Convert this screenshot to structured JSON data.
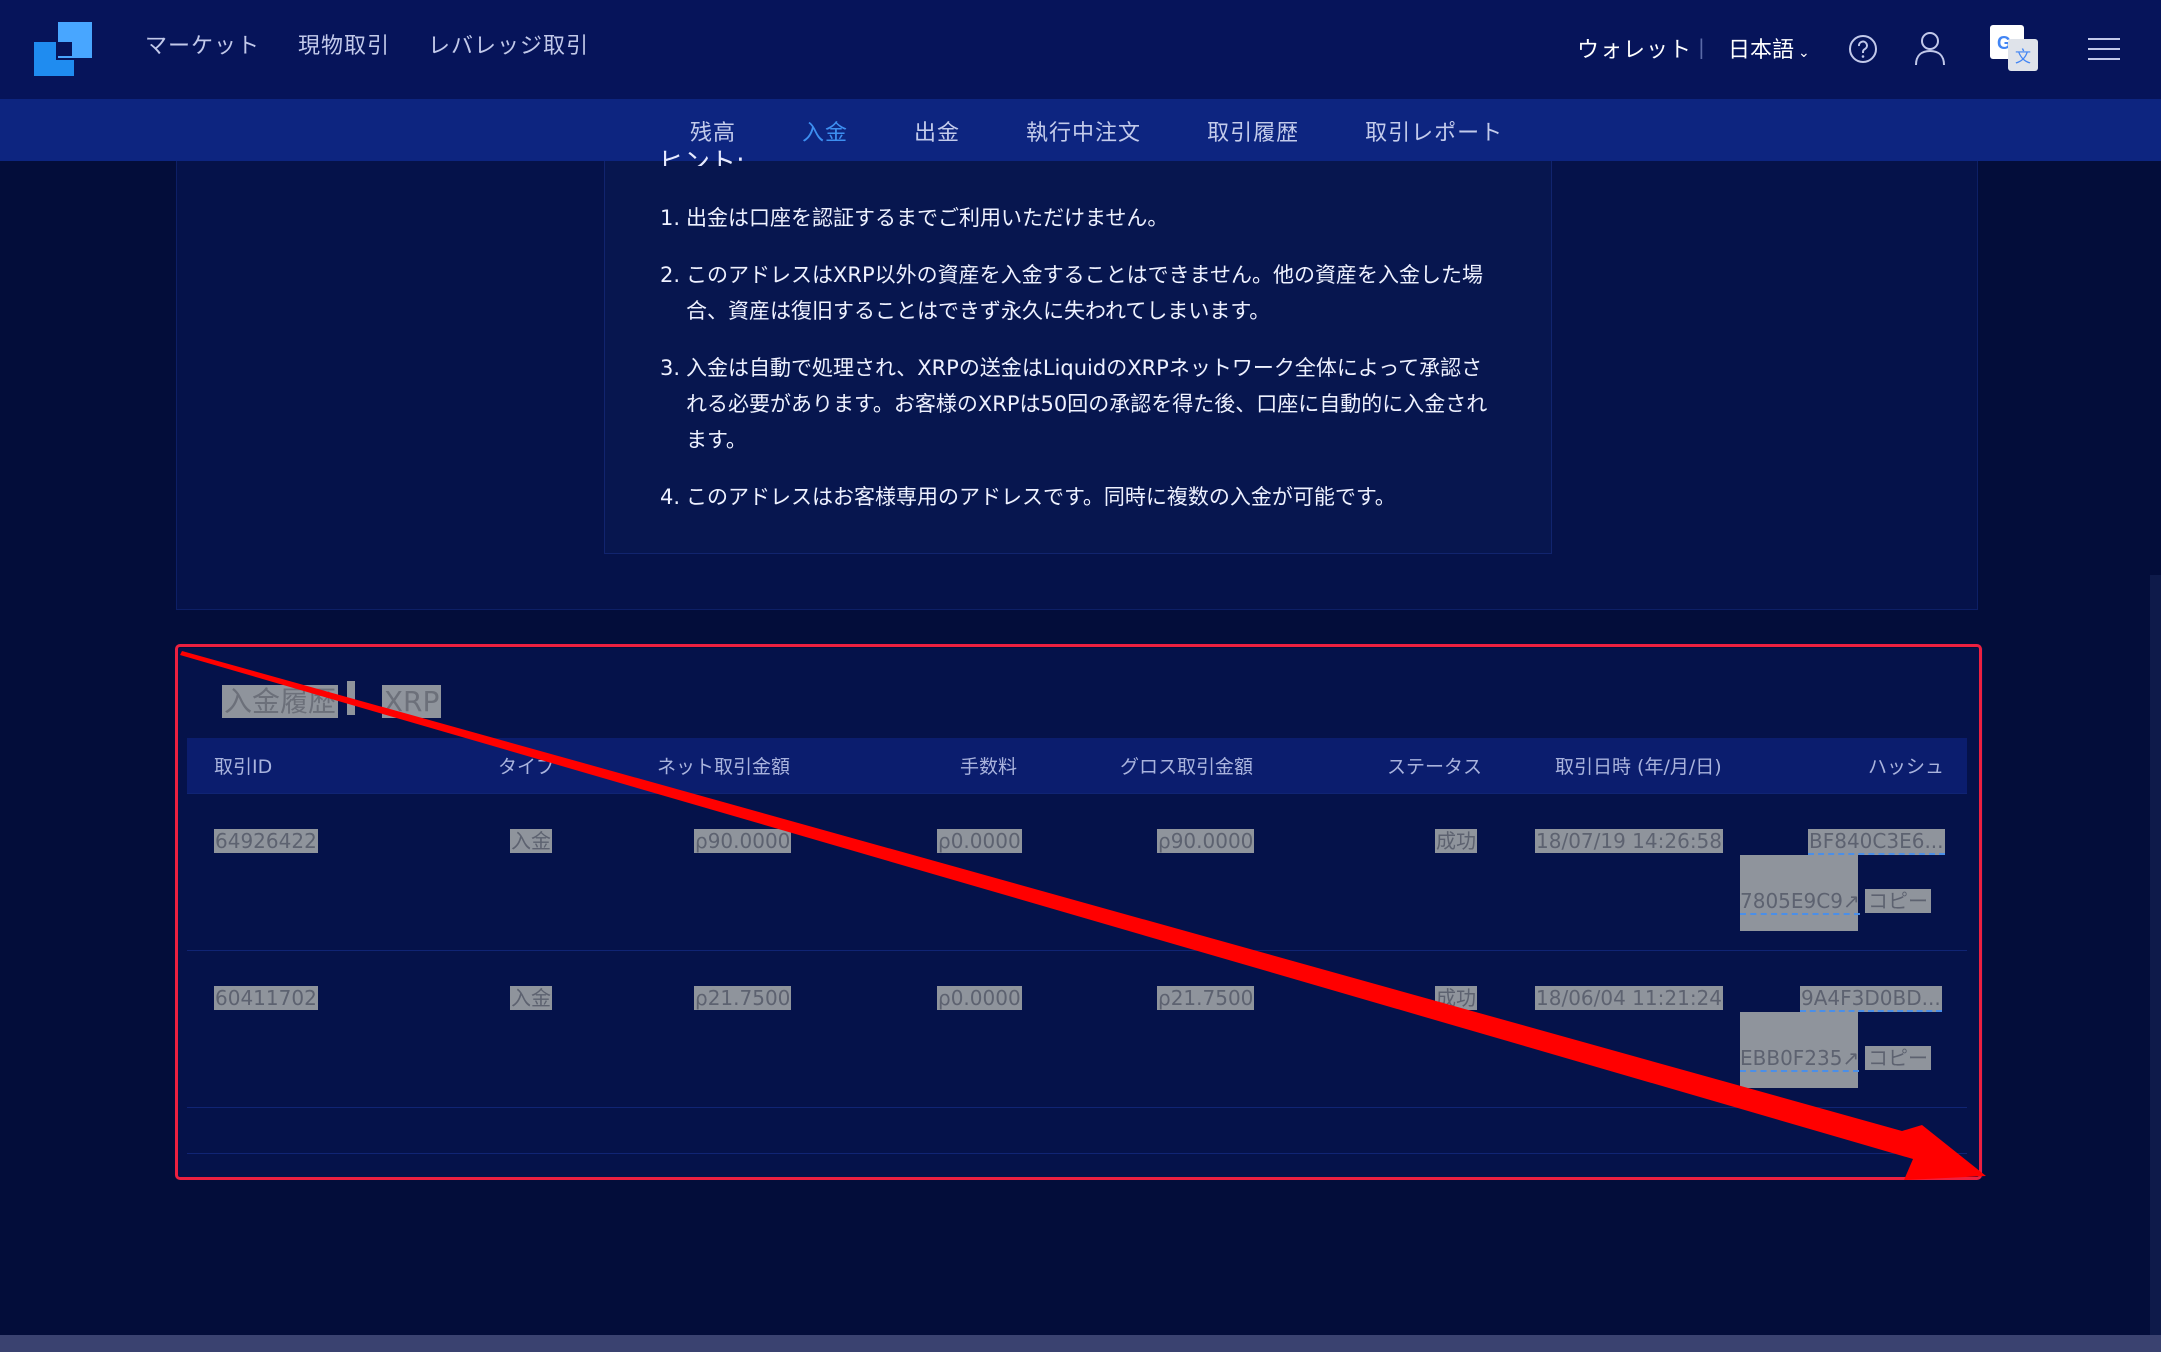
{
  "nav": {
    "links": [
      "マーケット",
      "現物取引",
      "レバレッジ取引"
    ],
    "wallet": "ウォレット",
    "separator": "|",
    "language": "日本語",
    "language_caret": "⌄"
  },
  "tabs": [
    {
      "label": "残高",
      "active": false
    },
    {
      "label": "入金",
      "active": true
    },
    {
      "label": "出金",
      "active": false
    },
    {
      "label": "執行中注文",
      "active": false
    },
    {
      "label": "取引履歴",
      "active": false
    },
    {
      "label": "取引レポート",
      "active": false
    }
  ],
  "hint": {
    "title": "ヒント:",
    "items": [
      {
        "num": "1.",
        "text": "出金は口座を認証するまでご利用いただけません。"
      },
      {
        "num": "2.",
        "text": "このアドレスはXRP以外の資産を入金することはできません。他の資産を入金した場合、資産は復旧することはできず永久に失われてしまいます。"
      },
      {
        "num": "3.",
        "text": "入金は自動で処理され、XRPの送金はLiquidのXRPネットワーク全体によって承認される必要があります。お客様のXRPは50回の承認を得た後、口座に自動的に入金されます。"
      },
      {
        "num": "4.",
        "text": "このアドレスはお客様専用のアドレスです。同時に複数の入金が可能です。"
      }
    ]
  },
  "history": {
    "title": "入金履歴",
    "asset": "XRP",
    "headers": [
      "取引ID",
      "タイプ",
      "ネット取引金額",
      "手数料",
      "グロス取引金額",
      "ステータス",
      "取引日時 (年/月/日)",
      "ハッシュ"
    ],
    "rows": [
      {
        "id": "64926422",
        "type": "入金",
        "net": "ρ90.0000",
        "fee": "ρ0.0000",
        "gross": "ρ90.0000",
        "status": "成功",
        "datetime": "18/07/19 14:26:58",
        "hash_top": "BF840C3E6...",
        "hash_bottom": "7805E9C9↗",
        "copy": "コピー"
      },
      {
        "id": "60411702",
        "type": "入金",
        "net": "ρ21.7500",
        "fee": "ρ0.0000",
        "gross": "ρ21.7500",
        "status": "成功",
        "datetime": "18/06/04 11:21:24",
        "hash_top": "9A4F3D0BD...",
        "hash_bottom": "EBB0F235↗",
        "copy": "コピー"
      }
    ]
  },
  "colors": {
    "accent": "#3d8ff0",
    "annotation": "#ec2040",
    "arrow": "#ff0000"
  }
}
